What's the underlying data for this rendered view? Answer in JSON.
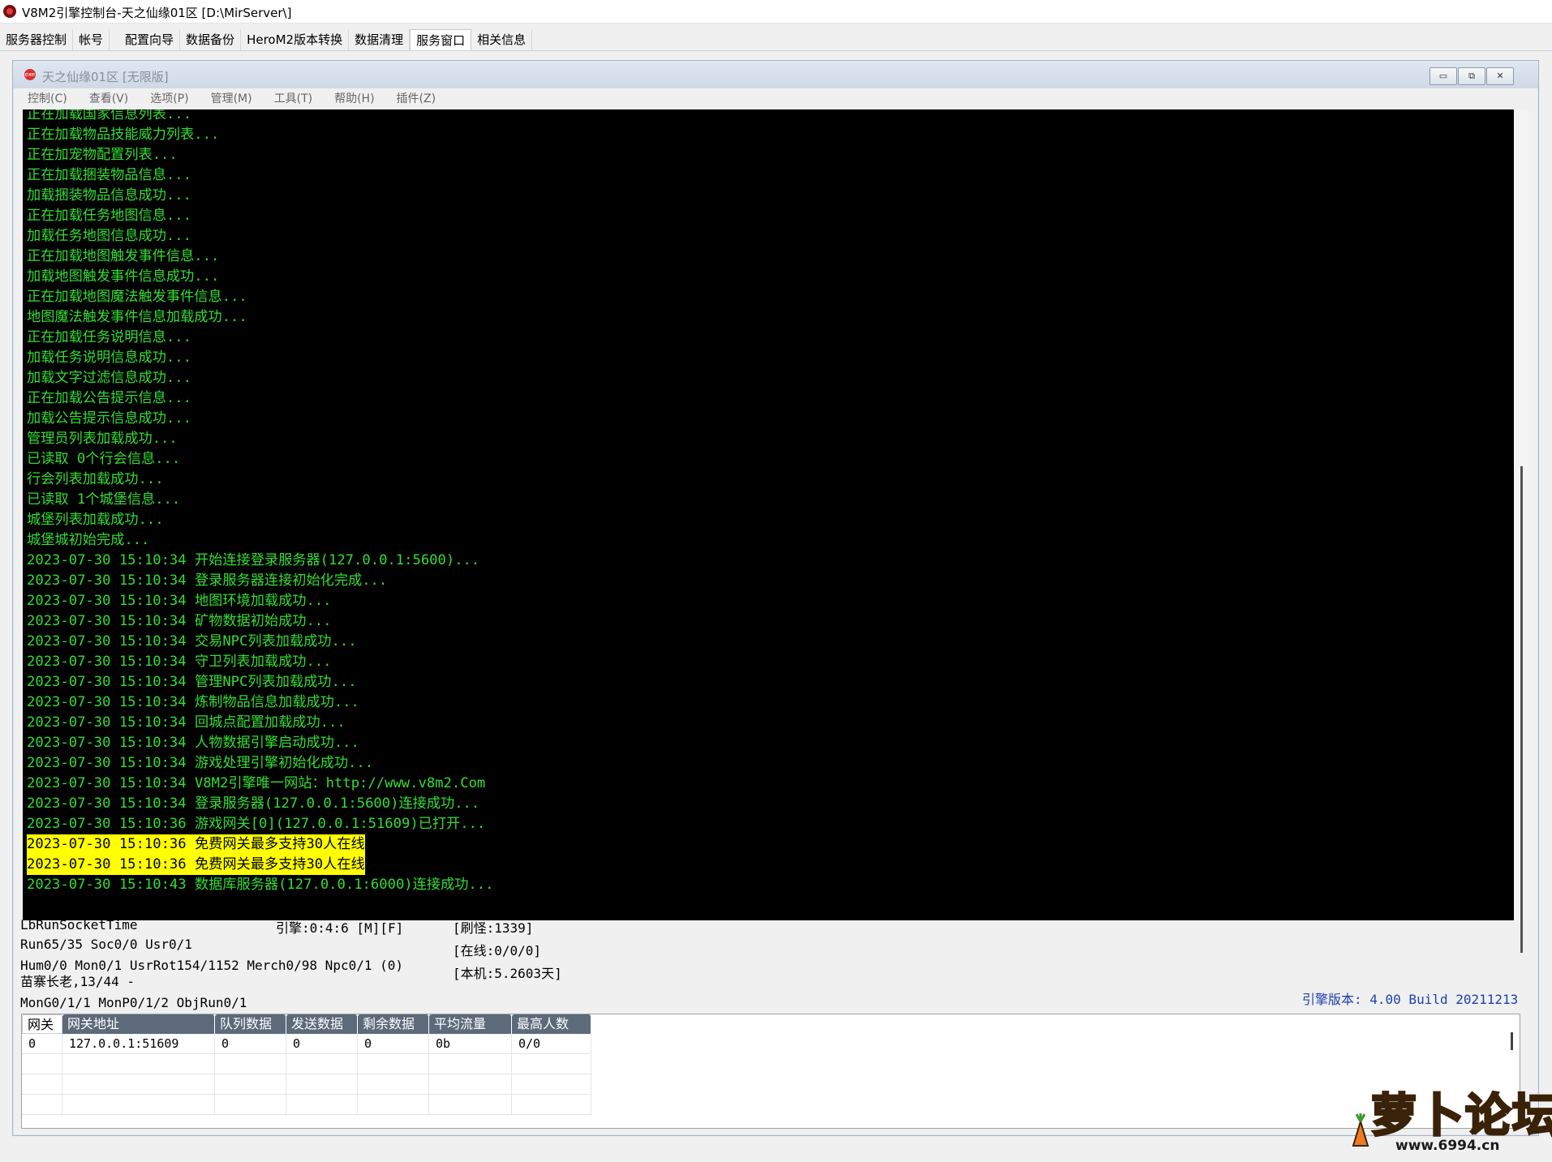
{
  "app": {
    "title": "V8M2引擎控制台-天之仙缘01区 [D:\\MirServer\\]",
    "tabs": [
      "服务器控制",
      "帐号",
      "配置向导",
      "数据备份",
      "HeroM2版本转换",
      "数据清理",
      "服务窗口",
      "相关信息"
    ],
    "active_tab": "服务窗口"
  },
  "window": {
    "icon_text": "exe",
    "title": "天之仙缘01区 [无限版]",
    "menu": [
      "控制(C)",
      "查看(V)",
      "选项(P)",
      "管理(M)",
      "工具(T)",
      "帮助(H)",
      "插件(Z)"
    ],
    "minimize_glyph": "▭",
    "restore_glyph": "⧉",
    "close_glyph": "✕"
  },
  "console": {
    "lines": [
      "正在加载国家信息列表...",
      "正在加载物品技能威力列表...",
      "正在加宠物配置列表...",
      "正在加载捆装物品信息...",
      "加载捆装物品信息成功...",
      "正在加载任务地图信息...",
      "加载任务地图信息成功...",
      "正在加载地图触发事件信息...",
      "加载地图触发事件信息成功...",
      "正在加载地图魔法触发事件信息...",
      "地图魔法触发事件信息加载成功...",
      "正在加载任务说明信息...",
      "加载任务说明信息成功...",
      "加载文字过滤信息成功...",
      "正在加载公告提示信息...",
      "加载公告提示信息成功...",
      "管理员列表加载成功...",
      "已读取 0个行会信息...",
      "行会列表加载成功...",
      "已读取 1个城堡信息...",
      "城堡列表加载成功...",
      "城堡城初始完成...",
      "2023-07-30 15:10:34 开始连接登录服务器(127.0.0.1:5600)...",
      "2023-07-30 15:10:34 登录服务器连接初始化完成...",
      "2023-07-30 15:10:34 地图环境加载成功...",
      "2023-07-30 15:10:34 矿物数据初始成功...",
      "2023-07-30 15:10:34 交易NPC列表加载成功...",
      "2023-07-30 15:10:34 守卫列表加载成功...",
      "2023-07-30 15:10:34 管理NPC列表加载成功...",
      "2023-07-30 15:10:34 炼制物品信息加载成功...",
      "2023-07-30 15:10:34 回城点配置加载成功...",
      "2023-07-30 15:10:34 人物数据引擎启动成功...",
      "2023-07-30 15:10:34 游戏处理引擎初始化成功...",
      "2023-07-30 15:10:34 V8M2引擎唯一网站：http://www.v8m2.Com",
      "2023-07-30 15:10:34 登录服务器(127.0.0.1:5600)连接成功...",
      "2023-07-30 15:10:36 游戏网关[0](127.0.0.1:51609)已打开...",
      "2023-07-30 15:10:36 免费网关最多支持30人在线",
      "2023-07-30 15:10:36 免费网关最多支持30人在线",
      "2023-07-30 15:10:43 数据库服务器(127.0.0.1:6000)连接成功..."
    ],
    "highlighted_lines": [
      36,
      37
    ],
    "text_color": "#33dd33",
    "highlight_color": "#ffff00"
  },
  "status": {
    "l1": "LbRunSocketTime",
    "l2": "Run65/35 Soc0/0 Usr0/1",
    "l3": "Hum0/0 Mon0/1 UsrRot154/1152 Merch0/98 Npc0/1 (0)",
    "l4": "苗寨长老,13/44 -",
    "l5": "MonG0/1/1 MonP0/1/2 ObjRun0/1",
    "engine": "引擎:0:4:6 [M][F]",
    "refresh": "[刷怪:1339]",
    "online": "[在线:0/0/0]",
    "uptime": "[本机:5.2603天]",
    "version": "引擎版本: 4.00 Build 20211213"
  },
  "gateway_table": {
    "columns": [
      "网关",
      "网关地址",
      "队列数据",
      "发送数据",
      "剩余数据",
      "平均流量",
      "最高人数"
    ],
    "rows": [
      [
        "0",
        "127.0.0.1:51609",
        "0",
        "0",
        "0",
        "0b",
        "0/0"
      ],
      [
        "",
        "",
        "",
        "",
        "",
        "",
        ""
      ],
      [
        "",
        "",
        "",
        "",
        "",
        "",
        ""
      ],
      [
        "",
        "",
        "",
        "",
        "",
        "",
        ""
      ]
    ]
  },
  "watermark": {
    "text": "萝卜论坛",
    "url": "www.6994.cn"
  }
}
